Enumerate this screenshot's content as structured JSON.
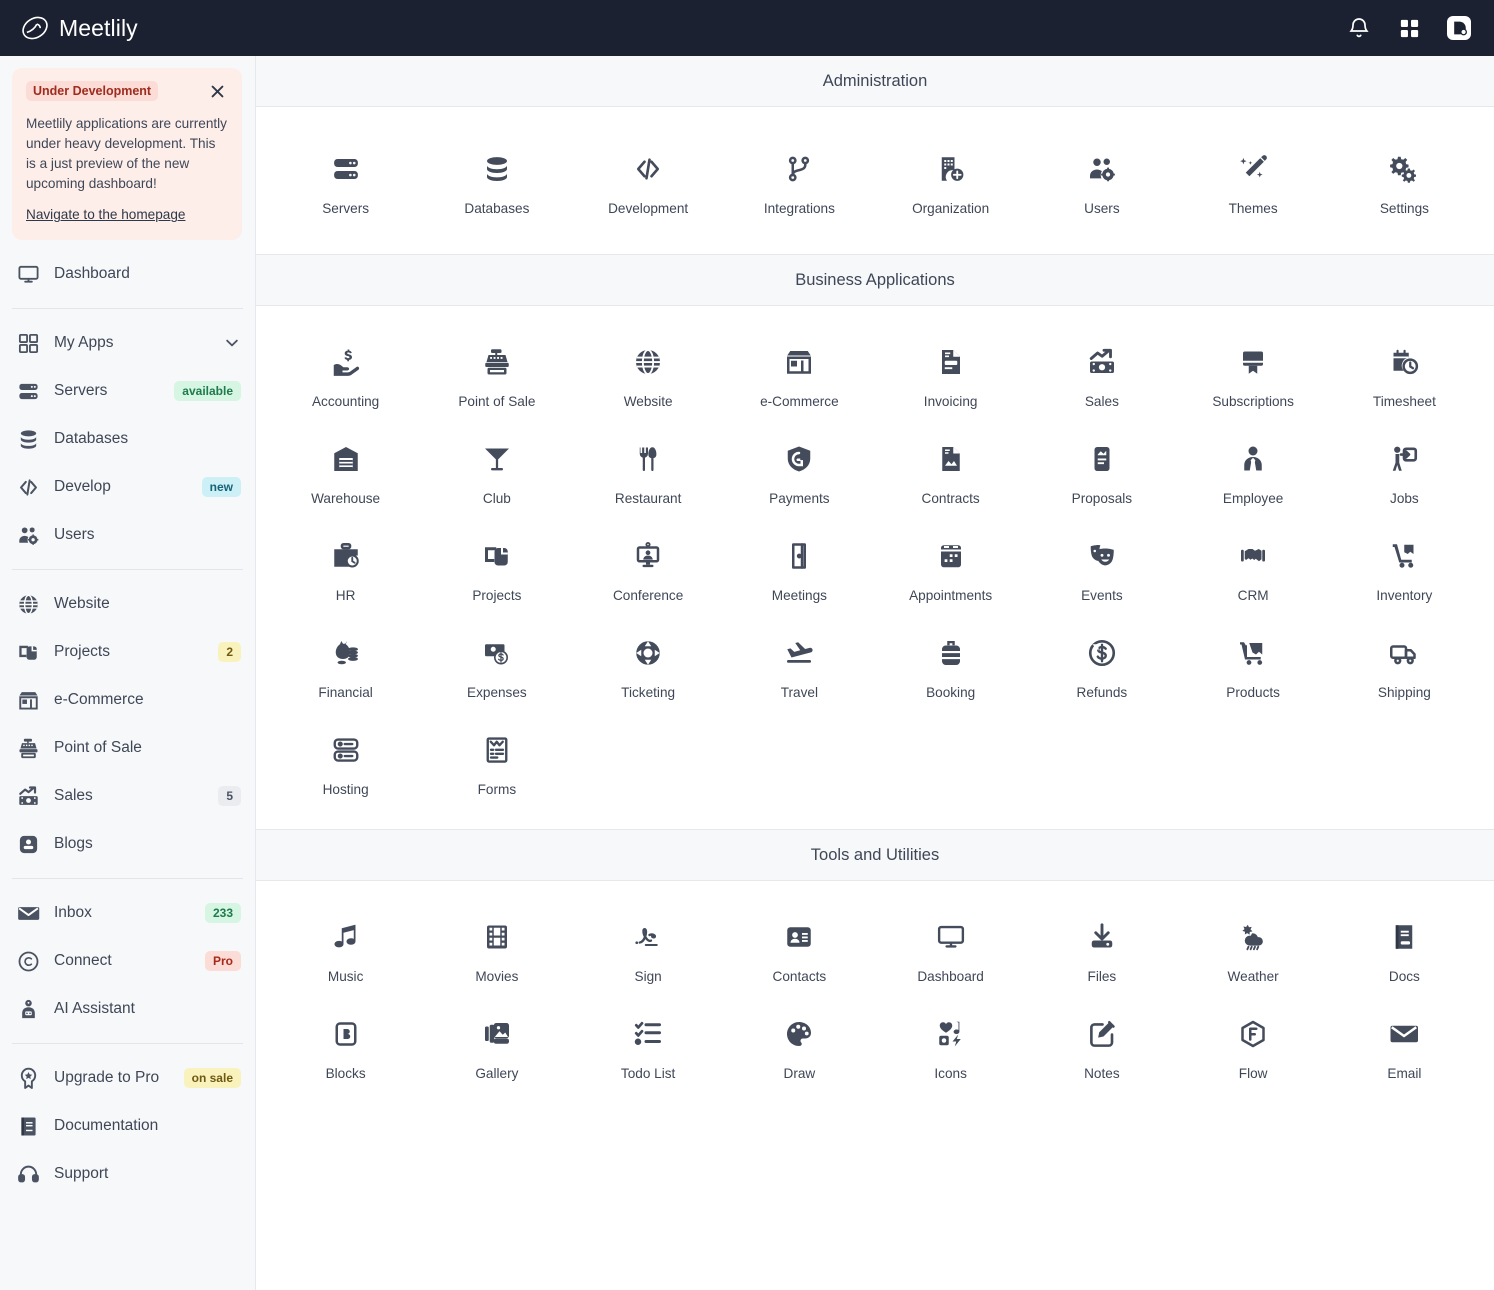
{
  "header": {
    "brand": "Meetlily",
    "icons": [
      {
        "name": "notifications-bell-icon",
        "label": "Notifications"
      },
      {
        "name": "apps-grid-icon",
        "label": "Apps"
      },
      {
        "name": "account-avatar-icon",
        "label": "Account"
      }
    ]
  },
  "sidebar": {
    "alert": {
      "tag": "Under Development",
      "text": "Meetlily applications are currently under heavy development. This is a just preview of the new upcoming dashboard!",
      "link": "Navigate to the homepage",
      "close_icon": "close-icon",
      "bg_color": "#fdeeea",
      "tag_color": "#9e2b1e"
    },
    "groups": [
      {
        "items": [
          {
            "label": "Dashboard",
            "icon": "monitor-icon",
            "badge": null,
            "badge_style": null,
            "chevron": false
          }
        ]
      },
      {
        "items": [
          {
            "label": "My Apps",
            "icon": "grid-icon",
            "badge": null,
            "badge_style": null,
            "chevron": true
          },
          {
            "label": "Servers",
            "icon": "server-icon",
            "badge": "available",
            "badge_style": "green",
            "chevron": false
          },
          {
            "label": "Databases",
            "icon": "database-icon",
            "badge": null,
            "badge_style": null,
            "chevron": false
          },
          {
            "label": "Develop",
            "icon": "code-icon",
            "badge": "new",
            "badge_style": "cyan",
            "chevron": false
          },
          {
            "label": "Users",
            "icon": "users-cog-icon",
            "badge": null,
            "badge_style": null,
            "chevron": false
          }
        ]
      },
      {
        "items": [
          {
            "label": "Website",
            "icon": "globe-icon",
            "badge": null,
            "badge_style": null,
            "chevron": false
          },
          {
            "label": "Projects",
            "icon": "projects-icon",
            "badge": "2",
            "badge_style": "yellow",
            "chevron": false
          },
          {
            "label": "e-Commerce",
            "icon": "store-icon",
            "badge": null,
            "badge_style": null,
            "chevron": false
          },
          {
            "label": "Point of Sale",
            "icon": "cash-register-icon",
            "badge": null,
            "badge_style": null,
            "chevron": false
          },
          {
            "label": "Sales",
            "icon": "sales-chart-icon",
            "badge": "5",
            "badge_style": "gray",
            "chevron": false
          },
          {
            "label": "Blogs",
            "icon": "blogger-icon",
            "badge": null,
            "badge_style": null,
            "chevron": false
          }
        ]
      },
      {
        "items": [
          {
            "label": "Inbox",
            "icon": "envelope-icon",
            "badge": "233",
            "badge_style": "green",
            "chevron": false
          },
          {
            "label": "Connect",
            "icon": "copyright-circle-icon",
            "badge": "Pro",
            "badge_style": "pink",
            "chevron": false
          },
          {
            "label": "AI Assistant",
            "icon": "robot-icon",
            "badge": null,
            "badge_style": null,
            "chevron": false
          }
        ]
      },
      {
        "items": [
          {
            "label": "Upgrade to Pro",
            "icon": "award-star-icon",
            "badge": "on sale",
            "badge_style": "yellow",
            "chevron": false
          },
          {
            "label": "Documentation",
            "icon": "book-icon",
            "badge": null,
            "badge_style": null,
            "chevron": false
          },
          {
            "label": "Support",
            "icon": "headset-icon",
            "badge": null,
            "badge_style": null,
            "chevron": false
          }
        ]
      }
    ]
  },
  "main": {
    "sections": [
      {
        "title": "Administration",
        "tiles": [
          {
            "label": "Servers",
            "icon": "server-icon"
          },
          {
            "label": "Databases",
            "icon": "database-icon"
          },
          {
            "label": "Development",
            "icon": "code-icon"
          },
          {
            "label": "Integrations",
            "icon": "code-branch-icon"
          },
          {
            "label": "Organization",
            "icon": "building-add-icon"
          },
          {
            "label": "Users",
            "icon": "users-cog-icon"
          },
          {
            "label": "Themes",
            "icon": "magic-wand-icon"
          },
          {
            "label": "Settings",
            "icon": "gears-icon"
          }
        ]
      },
      {
        "title": "Business Applications",
        "tiles": [
          {
            "label": "Accounting",
            "icon": "hand-dollar-icon"
          },
          {
            "label": "Point of Sale",
            "icon": "cash-register-icon"
          },
          {
            "label": "Website",
            "icon": "globe-icon"
          },
          {
            "label": "e-Commerce",
            "icon": "store-icon"
          },
          {
            "label": "Invoicing",
            "icon": "invoice-icon"
          },
          {
            "label": "Sales",
            "icon": "sales-chart-icon"
          },
          {
            "label": "Subscriptions",
            "icon": "subscription-card-icon"
          },
          {
            "label": "Timesheet",
            "icon": "calendar-clock-icon"
          },
          {
            "label": "Warehouse",
            "icon": "warehouse-icon"
          },
          {
            "label": "Club",
            "icon": "cocktail-icon"
          },
          {
            "label": "Restaurant",
            "icon": "fork-knife-icon"
          },
          {
            "label": "Payments",
            "icon": "payment-shield-icon"
          },
          {
            "label": "Contracts",
            "icon": "contract-file-icon"
          },
          {
            "label": "Proposals",
            "icon": "proposal-file-icon"
          },
          {
            "label": "Employee",
            "icon": "employee-tie-icon"
          },
          {
            "label": "Jobs",
            "icon": "jobs-person-icon"
          },
          {
            "label": "HR",
            "icon": "briefcase-clock-icon"
          },
          {
            "label": "Projects",
            "icon": "projects-icon"
          },
          {
            "label": "Conference",
            "icon": "conference-screen-icon"
          },
          {
            "label": "Meetings",
            "icon": "door-open-icon"
          },
          {
            "label": "Appointments",
            "icon": "appointment-calendar-icon"
          },
          {
            "label": "Events",
            "icon": "theater-masks-icon"
          },
          {
            "label": "CRM",
            "icon": "handshake-icon"
          },
          {
            "label": "Inventory",
            "icon": "dolly-box-icon"
          },
          {
            "label": "Financial",
            "icon": "money-bag-coins-icon"
          },
          {
            "label": "Expenses",
            "icon": "banknote-dollar-icon"
          },
          {
            "label": "Ticketing",
            "icon": "life-ring-icon"
          },
          {
            "label": "Travel",
            "icon": "plane-landing-icon"
          },
          {
            "label": "Booking",
            "icon": "suitcase-icon"
          },
          {
            "label": "Refunds",
            "icon": "refund-circle-icon"
          },
          {
            "label": "Products",
            "icon": "cart-box-icon"
          },
          {
            "label": "Shipping",
            "icon": "truck-icon"
          },
          {
            "label": "Hosting",
            "icon": "hosting-server-icon"
          },
          {
            "label": "Forms",
            "icon": "forms-icon"
          }
        ]
      },
      {
        "title": "Tools and Utilities",
        "tiles": [
          {
            "label": "Music",
            "icon": "music-note-icon"
          },
          {
            "label": "Movies",
            "icon": "film-icon"
          },
          {
            "label": "Sign",
            "icon": "signature-icon"
          },
          {
            "label": "Contacts",
            "icon": "contact-card-icon"
          },
          {
            "label": "Dashboard",
            "icon": "monitor-icon"
          },
          {
            "label": "Files",
            "icon": "download-files-icon"
          },
          {
            "label": "Weather",
            "icon": "weather-cloud-sun-rain-icon"
          },
          {
            "label": "Docs",
            "icon": "docs-book-icon"
          },
          {
            "label": "Blocks",
            "icon": "blocks-b-icon"
          },
          {
            "label": "Gallery",
            "icon": "gallery-images-icon"
          },
          {
            "label": "Todo List",
            "icon": "checklist-icon"
          },
          {
            "label": "Draw",
            "icon": "palette-icon"
          },
          {
            "label": "Icons",
            "icon": "icons-shapes-icon"
          },
          {
            "label": "Notes",
            "icon": "note-pencil-icon"
          },
          {
            "label": "Flow",
            "icon": "flow-hexagon-f-icon"
          },
          {
            "label": "Email",
            "icon": "envelope-icon"
          }
        ]
      }
    ]
  },
  "colors": {
    "topbar_bg": "#1b2130",
    "sidebar_bg": "#f7f8fa",
    "icon": "#444c5c",
    "text": "#3f4757"
  }
}
